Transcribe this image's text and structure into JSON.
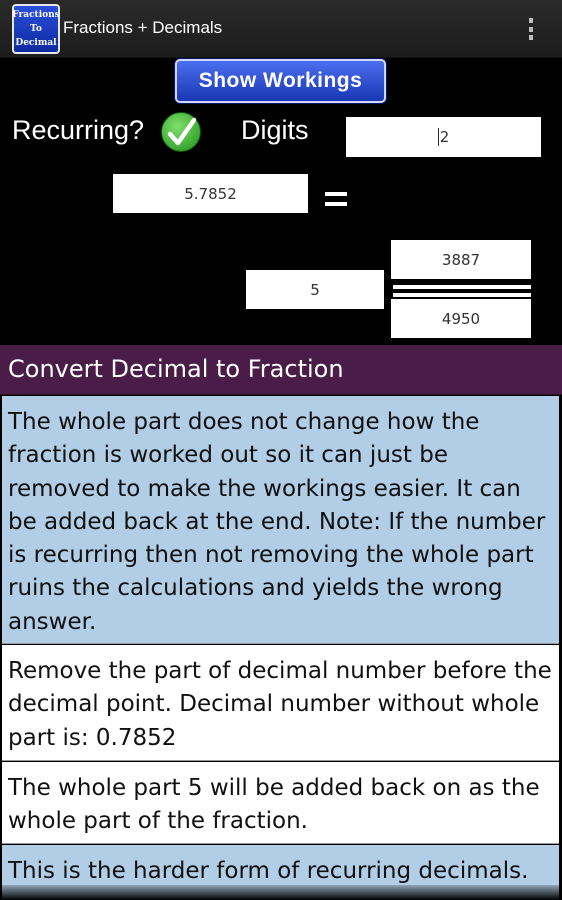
{
  "app": {
    "icon_lines": [
      "Fractions",
      "To",
      "Decimal"
    ],
    "title": "Fractions + Decimals"
  },
  "controls": {
    "show_workings_label": "Show Workings",
    "recurring_label": "Recurring?",
    "recurring_checked": true,
    "digits_label": "Digits",
    "digits_value": "2",
    "decimal_value": "5.7852",
    "equals_symbol": "="
  },
  "fraction": {
    "whole": "5",
    "numerator": "3887",
    "denominator": "4950"
  },
  "workings": {
    "title": "Convert Decimal to Fraction",
    "steps": [
      "The whole part does not change how the fraction is worked out so it can just be removed to make the workings easier.  It can be added back at the end.  Note: If the number is recurring then not removing the whole part ruins the calculations and yields the wrong answer.",
      "Remove the part of decimal number before the decimal point.  Decimal number without whole part is: 0.7852",
      "The whole part 5 will be added back on as the whole part of the fraction.",
      "This is the harder form of recurring decimals."
    ]
  },
  "colors": {
    "header_purple": "#4a1d48",
    "step_blue": "#b2cde6",
    "button_blue": "#2d4fd6",
    "check_green": "#3cb832"
  }
}
